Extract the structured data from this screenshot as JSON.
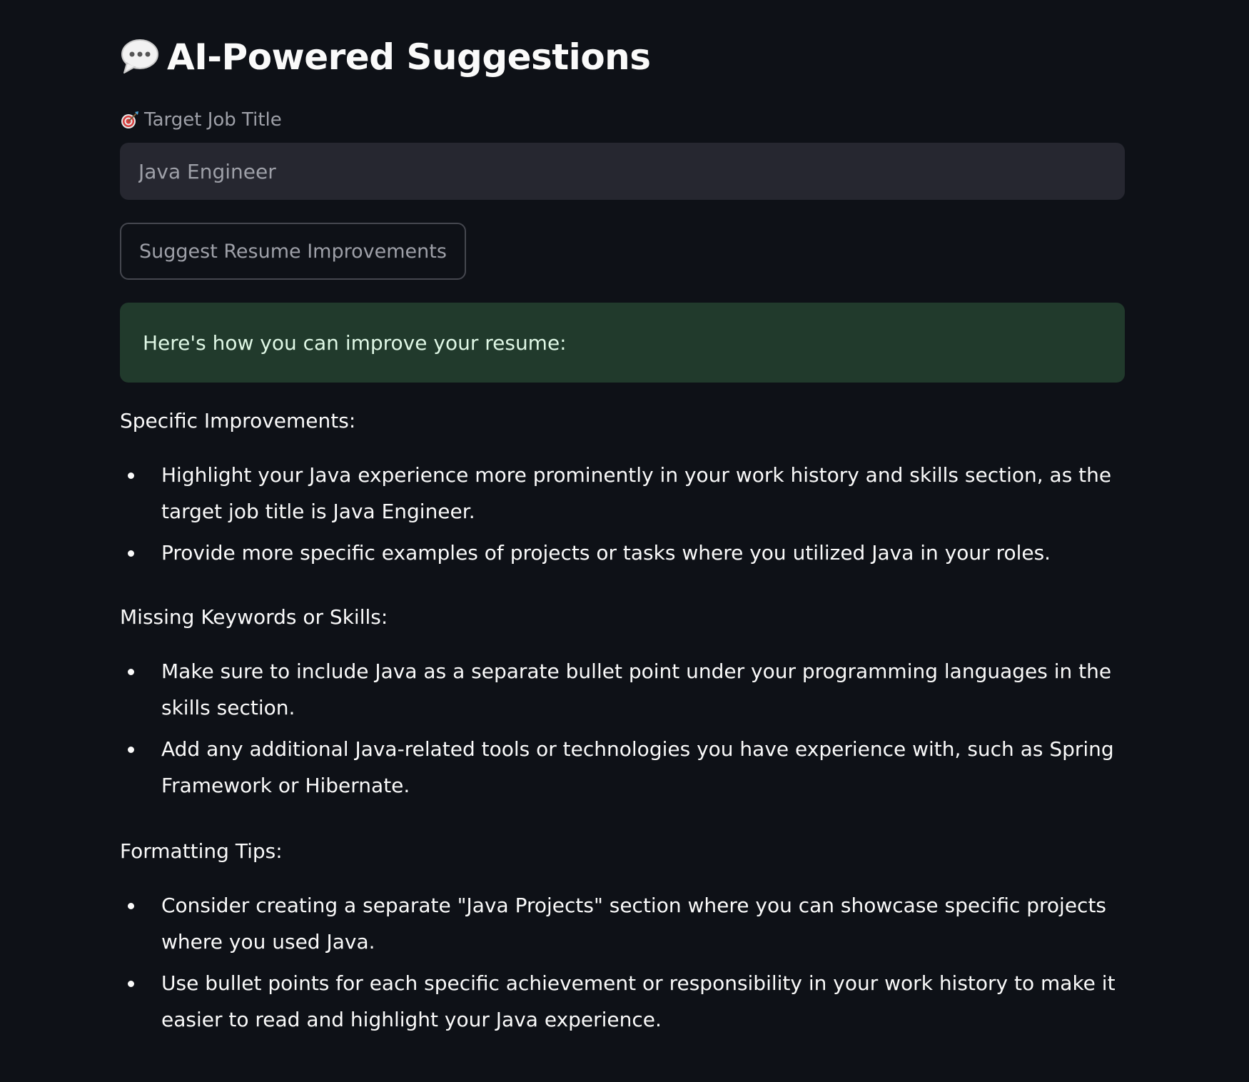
{
  "header": {
    "icon": "speech-bubble-icon",
    "title": "AI-Powered Suggestions"
  },
  "job_title_field": {
    "icon": "target-icon",
    "label": "Target Job Title",
    "value": "Java Engineer"
  },
  "suggest_button": {
    "label": "Suggest Resume Improvements"
  },
  "success_message": {
    "text": "Here's how you can improve your resume:",
    "background": "#213a2c"
  },
  "sections": [
    {
      "heading": "Specific Improvements:",
      "items": [
        "Highlight your Java experience more prominently in your work history and skills section, as the target job title is Java Engineer.",
        "Provide more specific examples of projects or tasks where you utilized Java in your roles."
      ]
    },
    {
      "heading": "Missing Keywords or Skills:",
      "items": [
        "Make sure to include Java as a separate bullet point under your programming languages in the skills section.",
        "Add any additional Java-related tools or technologies you have experience with, such as Spring Framework or Hibernate."
      ]
    },
    {
      "heading": "Formatting Tips:",
      "items": [
        "Consider creating a separate \"Java Projects\" section where you can showcase specific projects where you used Java.",
        "Use bullet points for each specific achievement or responsibility in your work history to make it easier to read and highlight your Java experience."
      ]
    }
  ],
  "colors": {
    "background": "#0e1117",
    "input_background": "#262730",
    "text": "#fafafa",
    "muted_text": "#9ea0a8"
  }
}
